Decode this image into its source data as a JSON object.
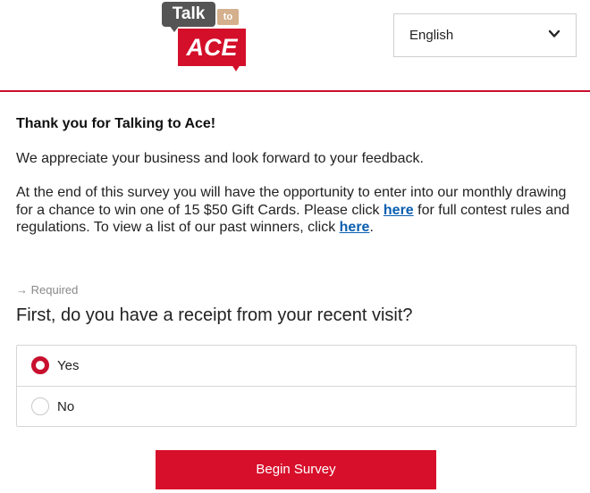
{
  "header": {
    "logo": {
      "talk_text": "Talk",
      "to_text": "to",
      "brand_text": "ACE"
    },
    "language_select": {
      "selected": "English",
      "icon": "chevron-down-icon"
    }
  },
  "intro": {
    "title": "Thank you for Talking to Ace!",
    "paragraph1": "We appreciate your business and look forward to your feedback.",
    "paragraph2_part1": "At the end of this survey you will have the opportunity to enter into our monthly drawing for a chance to win one of 15 $50 Gift Cards. Please click ",
    "link1_text": "here",
    "paragraph2_part2": " for full contest rules and regulations. To view a list of our past winners, click ",
    "link2_text": "here",
    "paragraph2_part3": "."
  },
  "question": {
    "required_text": "→ Required",
    "text": "First, do you have a receipt from your recent visit?",
    "options": [
      {
        "label": "Yes",
        "selected": true
      },
      {
        "label": "No",
        "selected": false
      }
    ]
  },
  "actions": {
    "begin_label": "Begin Survey"
  },
  "colors": {
    "brand_red": "#d70f2b",
    "talk_gray": "#555555",
    "to_tan": "#d4b08c",
    "link_blue": "#0a5fb0"
  }
}
